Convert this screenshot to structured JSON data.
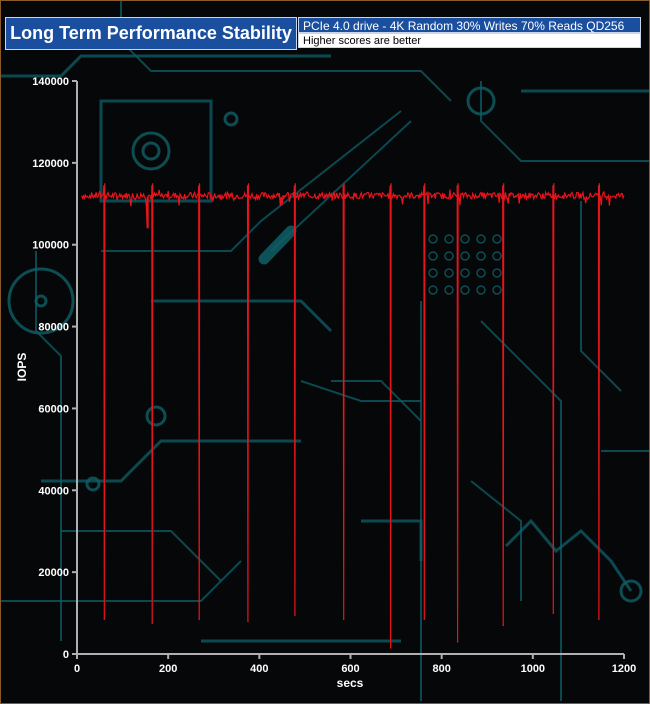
{
  "header": {
    "title": "Long Term Performance Stability",
    "series_label": "PCIe 4.0 drive - 4K Random 30% Writes 70% Reads QD256",
    "note": "Higher scores are better"
  },
  "colors": {
    "title_background": "#1a4fa0",
    "series_line": "#e8141c",
    "axis": "#b0b0b0",
    "background": "#050708",
    "circuit_decoration": "#0f5f68"
  },
  "chart_data": {
    "type": "line",
    "title": "Long Term Performance Stability",
    "xlabel": "secs",
    "ylabel": "IOPS",
    "xlim": [
      0,
      1200
    ],
    "ylim": [
      0,
      140000
    ],
    "x_ticks": [
      0,
      200,
      400,
      600,
      800,
      1000,
      1200
    ],
    "y_ticks": [
      0,
      20000,
      40000,
      60000,
      80000,
      100000,
      120000,
      140000
    ],
    "grid": false,
    "series": [
      {
        "name": "PCIe 4.0 drive - 4K Random 30% Writes 70% Reads QD256",
        "baseline_iops": 112000,
        "x_range": [
          0,
          1200
        ],
        "dips": [
          {
            "x": 60,
            "y": 8500
          },
          {
            "x": 165,
            "y": 7500
          },
          {
            "x": 268,
            "y": 8500
          },
          {
            "x": 375,
            "y": 8000
          },
          {
            "x": 478,
            "y": 9500
          },
          {
            "x": 585,
            "y": 8500
          },
          {
            "x": 688,
            "y": 1500
          },
          {
            "x": 762,
            "y": 8500
          },
          {
            "x": 835,
            "y": 3000
          },
          {
            "x": 935,
            "y": 7000
          },
          {
            "x": 1045,
            "y": 10000
          },
          {
            "x": 1145,
            "y": 8500
          }
        ],
        "secondary_dip": {
          "x": 155,
          "y": 104000
        }
      }
    ]
  }
}
